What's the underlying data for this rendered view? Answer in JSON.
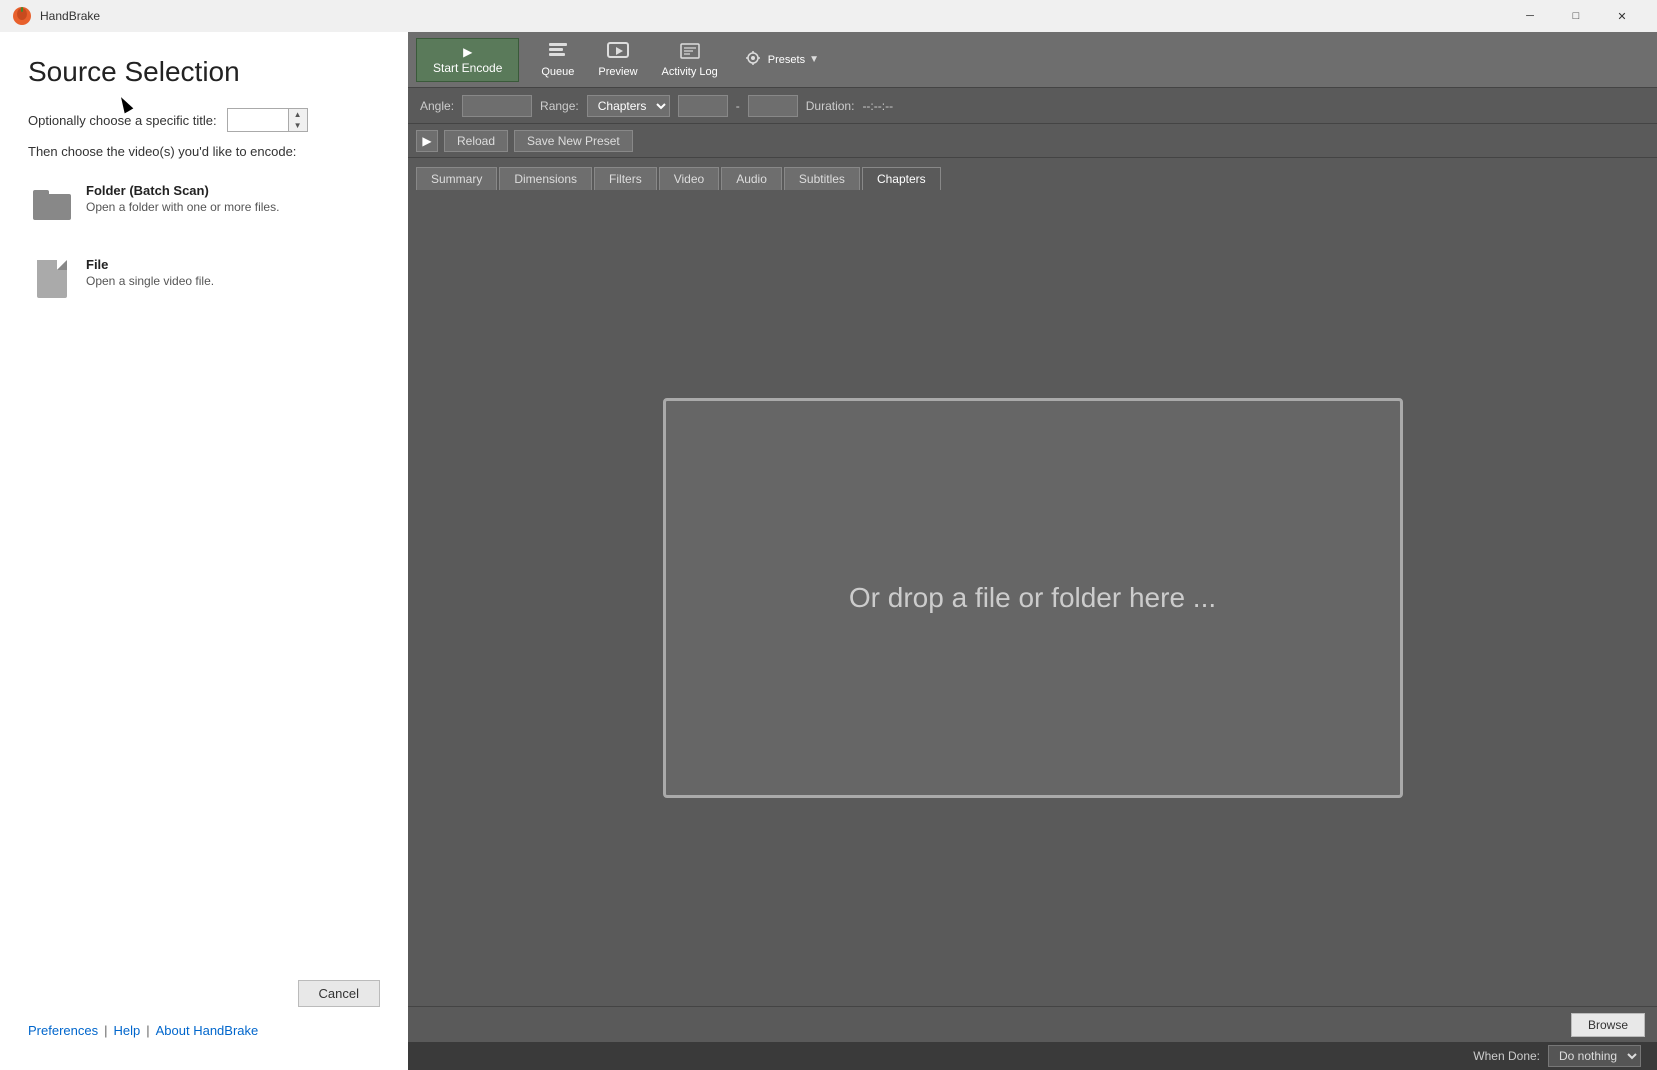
{
  "app": {
    "title": "HandBrake",
    "logo_emoji": "🍊"
  },
  "titlebar": {
    "title": "HandBrake",
    "minimize_label": "─",
    "maximize_label": "□",
    "close_label": "✕"
  },
  "source_panel": {
    "heading": "Source Selection",
    "title_label": "Optionally choose a specific title:",
    "title_placeholder": "",
    "choose_label": "Then choose the video(s) you'd like to encode:",
    "folder_option": {
      "title": "Folder (Batch Scan)",
      "desc": "Open a folder with one or more files."
    },
    "file_option": {
      "title": "File",
      "desc": "Open a single video file."
    },
    "cancel_label": "Cancel",
    "footer": {
      "preferences": "Preferences",
      "help": "Help",
      "about": "About HandBrake"
    }
  },
  "toolbar": {
    "start_encode": "Start Encode",
    "queue": "Queue",
    "preview": "Preview",
    "activity_log": "Activity Log",
    "presets": "Presets"
  },
  "range_bar": {
    "angle_label": "Angle:",
    "range_label": "Range:",
    "chapters_label": "Chapters",
    "duration_label": "Duration:",
    "duration_value": "--:--:--"
  },
  "preset_bar": {
    "reload_label": "Reload",
    "save_new_preset": "Save New Preset"
  },
  "tabs": {
    "items": [
      "Summary",
      "Dimensions",
      "Filters",
      "Video",
      "Audio",
      "Subtitles",
      "Chapters"
    ]
  },
  "drop_zone": {
    "text": "Or drop a file or folder here ..."
  },
  "bottom_bar": {
    "browse_label": "Browse"
  },
  "status_bar": {
    "when_done_label": "When Done:",
    "when_done_value": "Do nothing"
  }
}
